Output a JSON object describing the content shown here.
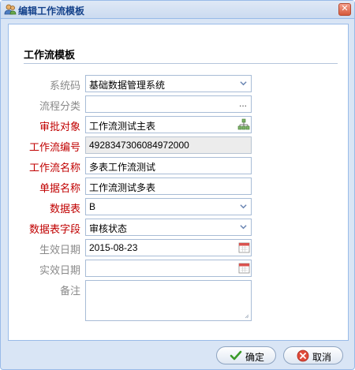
{
  "window": {
    "title": "编辑工作流模板"
  },
  "section": {
    "title": "工作流模板"
  },
  "fields": {
    "system_code": {
      "label": "系统码",
      "value": "基础数据管理系统"
    },
    "process_category": {
      "label": "流程分类",
      "value": "",
      "trigger": "..."
    },
    "approval_object": {
      "label": "审批对象",
      "value": "工作流测试主表"
    },
    "workflow_number": {
      "label": "工作流编号",
      "value": "4928347306084972000"
    },
    "workflow_name": {
      "label": "工作流名称",
      "value": "多表工作流测试"
    },
    "document_name": {
      "label": "单据名称",
      "value": "工作流测试多表"
    },
    "data_table": {
      "label": "数据表",
      "value": "B"
    },
    "data_table_field": {
      "label": "数据表字段",
      "value": "审核状态"
    },
    "effective_date": {
      "label": "生效日期",
      "value": "2015-08-23"
    },
    "expiry_date": {
      "label": "实效日期",
      "value": ""
    },
    "remarks": {
      "label": "备注",
      "value": ""
    }
  },
  "buttons": {
    "confirm": "确定",
    "cancel": "取消"
  },
  "colors": {
    "required_label": "#c00000",
    "optional_label": "#8a8a8a",
    "accent": "#99bbe8"
  }
}
